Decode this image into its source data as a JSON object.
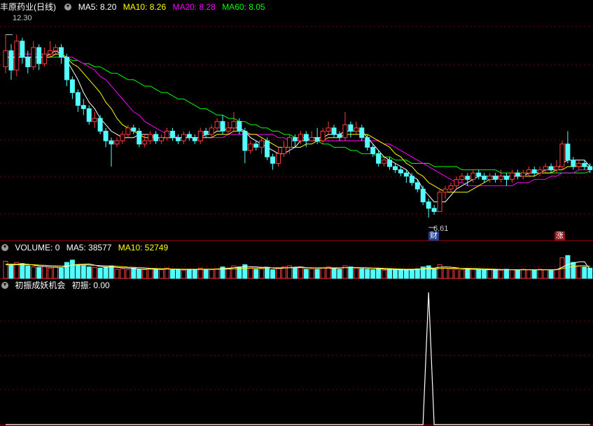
{
  "colors": {
    "up": "#ff3c3c",
    "down": "#54ffff",
    "ma5": "#ffffff",
    "ma10": "#ffff00",
    "ma20": "#ff00ff",
    "ma60": "#00ff00",
    "grid": "#7a0000",
    "vol_ma10": "#ffff00",
    "signal": "#ffffff"
  },
  "price_panel": {
    "stock_name": "丰原药业",
    "period": "(日线)",
    "ma5_label": "MA5: 8.20",
    "ma10_label": "MA10: 8.26",
    "ma20_label": "MA20: 8.28",
    "ma60_label": "MA60: 8.05",
    "high_label": "12.30",
    "low_label": "6.61",
    "badge_cai": "财",
    "badge_zhang": "涨"
  },
  "volume_panel": {
    "title": "VOLUME: 0",
    "ma5_label": "MA5: 38577",
    "ma10_label": "MA10: 52749"
  },
  "indicator_panel": {
    "title": "初振成妖机会",
    "value_label": "初振: 0.00"
  },
  "chart_data": [
    {
      "type": "candlestick",
      "title": "丰原药业(日线)",
      "high": 12.3,
      "low": 6.61,
      "ylim": [
        6.2,
        12.9
      ],
      "candles": [
        [
          11.3,
          11.8,
          12.3,
          11.1
        ],
        [
          11.8,
          11.2,
          12.0,
          10.9
        ],
        [
          11.2,
          12.1,
          12.3,
          11.0
        ],
        [
          12.1,
          11.6,
          12.2,
          11.4
        ],
        [
          11.6,
          11.3,
          11.8,
          11.1
        ],
        [
          11.3,
          11.9,
          12.1,
          11.2
        ],
        [
          11.9,
          11.4,
          12.0,
          11.2
        ],
        [
          11.4,
          11.7,
          11.9,
          11.3
        ],
        [
          11.7,
          11.8,
          12.1,
          11.6
        ],
        [
          11.8,
          11.9,
          12.0,
          11.7
        ],
        [
          11.9,
          11.6,
          12.0,
          11.4
        ],
        [
          11.6,
          10.9,
          11.7,
          10.7
        ],
        [
          10.9,
          10.5,
          11.0,
          10.3
        ],
        [
          10.5,
          10.1,
          10.6,
          9.9
        ],
        [
          10.1,
          10.0,
          10.3,
          9.8
        ],
        [
          10.0,
          9.6,
          10.1,
          9.5
        ],
        [
          9.6,
          9.7,
          9.9,
          9.4
        ],
        [
          9.7,
          9.3,
          9.8,
          9.2
        ],
        [
          9.3,
          9.0,
          9.4,
          8.8
        ],
        [
          9.0,
          8.9,
          9.1,
          8.2
        ],
        [
          8.9,
          9.0,
          9.1,
          8.8
        ],
        [
          9.0,
          9.2,
          9.3,
          8.9
        ],
        [
          9.2,
          9.4,
          9.5,
          9.1
        ],
        [
          9.4,
          9.3,
          9.5,
          9.2
        ],
        [
          9.3,
          8.9,
          9.4,
          8.8
        ],
        [
          8.9,
          9.0,
          9.2,
          8.8
        ],
        [
          9.0,
          9.2,
          9.3,
          8.9
        ],
        [
          9.2,
          9.0,
          9.3,
          8.9
        ],
        [
          9.0,
          9.1,
          9.2,
          8.9
        ],
        [
          9.1,
          9.3,
          9.4,
          9.0
        ],
        [
          9.3,
          9.1,
          9.4,
          9.0
        ],
        [
          9.1,
          9.0,
          9.2,
          8.9
        ],
        [
          9.0,
          9.2,
          9.3,
          8.9
        ],
        [
          9.2,
          9.1,
          9.3,
          9.0
        ],
        [
          9.1,
          9.0,
          9.2,
          8.9
        ],
        [
          9.0,
          9.3,
          9.4,
          8.9
        ],
        [
          9.3,
          9.2,
          9.4,
          9.1
        ],
        [
          9.2,
          9.4,
          9.5,
          9.1
        ],
        [
          9.4,
          9.6,
          9.7,
          9.3
        ],
        [
          9.6,
          9.3,
          9.8,
          9.2
        ],
        [
          9.3,
          9.4,
          9.6,
          9.2
        ],
        [
          9.4,
          9.6,
          9.9,
          9.3
        ],
        [
          9.6,
          9.3,
          9.7,
          9.2
        ],
        [
          9.3,
          8.7,
          9.4,
          8.3
        ],
        [
          8.7,
          8.9,
          9.0,
          8.6
        ],
        [
          8.9,
          8.8,
          9.0,
          8.7
        ],
        [
          8.8,
          9.0,
          9.1,
          8.6
        ],
        [
          9.0,
          8.5,
          9.1,
          8.4
        ],
        [
          8.5,
          8.3,
          8.6,
          8.1
        ],
        [
          8.3,
          8.6,
          8.8,
          8.2
        ],
        [
          8.6,
          8.8,
          9.0,
          8.5
        ],
        [
          8.8,
          9.1,
          9.2,
          8.6
        ],
        [
          9.1,
          9.0,
          9.2,
          8.8
        ],
        [
          9.0,
          9.2,
          9.3,
          8.9
        ],
        [
          9.2,
          9.0,
          9.3,
          8.8
        ],
        [
          9.0,
          9.1,
          9.3,
          9.0
        ],
        [
          9.1,
          9.0,
          9.4,
          8.9
        ],
        [
          9.0,
          9.3,
          9.4,
          8.9
        ],
        [
          9.3,
          9.4,
          9.6,
          9.2
        ],
        [
          9.4,
          9.2,
          9.5,
          9.1
        ],
        [
          9.2,
          9.1,
          9.3,
          9.0
        ],
        [
          9.1,
          9.5,
          9.9,
          9.0
        ],
        [
          9.5,
          9.3,
          9.6,
          9.1
        ],
        [
          9.3,
          9.4,
          9.6,
          9.2
        ],
        [
          9.4,
          9.1,
          9.5,
          9.0
        ],
        [
          9.1,
          8.8,
          9.2,
          8.7
        ],
        [
          8.8,
          8.6,
          8.9,
          8.5
        ],
        [
          8.6,
          8.3,
          8.7,
          8.2
        ],
        [
          8.3,
          8.4,
          8.5,
          8.2
        ],
        [
          8.4,
          8.2,
          8.5,
          8.1
        ],
        [
          8.2,
          8.1,
          8.3,
          8.0
        ],
        [
          8.1,
          8.0,
          8.2,
          7.9
        ],
        [
          8.0,
          7.9,
          8.1,
          7.7
        ],
        [
          7.9,
          7.7,
          8.0,
          7.6
        ],
        [
          7.7,
          7.5,
          7.8,
          7.4
        ],
        [
          7.5,
          7.1,
          7.6,
          7.0
        ],
        [
          7.1,
          6.9,
          7.2,
          6.61
        ],
        [
          6.9,
          6.8,
          7.0,
          6.7
        ],
        [
          6.8,
          7.4,
          7.5,
          6.8
        ],
        [
          7.4,
          7.5,
          7.6,
          7.2
        ],
        [
          7.5,
          7.6,
          7.7,
          7.4
        ],
        [
          7.6,
          7.8,
          7.9,
          7.5
        ],
        [
          7.8,
          7.9,
          8.0,
          7.7
        ],
        [
          7.9,
          7.8,
          8.0,
          7.6
        ],
        [
          7.8,
          8.0,
          8.1,
          7.7
        ],
        [
          8.0,
          7.9,
          8.1,
          7.8
        ],
        [
          7.9,
          7.8,
          8.0,
          7.7
        ],
        [
          7.8,
          7.9,
          8.0,
          7.7
        ],
        [
          7.9,
          7.8,
          8.0,
          7.7
        ],
        [
          7.8,
          7.9,
          8.1,
          7.7
        ],
        [
          7.9,
          7.8,
          8.0,
          7.6
        ],
        [
          7.8,
          8.0,
          8.1,
          7.7
        ],
        [
          8.0,
          7.9,
          8.1,
          7.8
        ],
        [
          7.9,
          8.0,
          8.1,
          7.8
        ],
        [
          8.0,
          8.1,
          8.2,
          7.9
        ],
        [
          8.1,
          8.0,
          8.2,
          7.9
        ],
        [
          8.0,
          8.1,
          8.2,
          7.9
        ],
        [
          8.1,
          8.2,
          8.3,
          8.0
        ],
        [
          8.2,
          8.1,
          8.3,
          8.0
        ],
        [
          8.1,
          8.2,
          8.4,
          8.0
        ],
        [
          8.2,
          8.9,
          9.0,
          8.1
        ],
        [
          8.9,
          8.4,
          9.3,
          8.3
        ],
        [
          8.4,
          8.2,
          8.5,
          8.1
        ],
        [
          8.2,
          8.3,
          8.4,
          8.1
        ],
        [
          8.3,
          8.2,
          8.4,
          8.1
        ],
        [
          8.2,
          8.1,
          8.3,
          8.0
        ]
      ],
      "ma5": [
        11.6,
        11.6,
        11.6,
        11.6,
        11.6,
        11.6,
        11.6,
        11.6,
        11.7,
        11.8,
        11.7,
        11.5,
        11.2,
        10.9,
        10.5,
        10.2,
        10.0,
        9.7,
        9.5,
        9.3,
        9.2,
        9.1,
        9.1,
        9.1,
        9.2,
        9.2,
        9.2,
        9.1,
        9.1,
        9.1,
        9.1,
        9.1,
        9.1,
        9.1,
        9.1,
        9.1,
        9.2,
        9.2,
        9.3,
        9.3,
        9.4,
        9.4,
        9.4,
        9.3,
        9.1,
        9.0,
        8.9,
        8.8,
        8.7,
        8.6,
        8.6,
        8.7,
        8.8,
        9.0,
        9.0,
        9.1,
        9.1,
        9.1,
        9.2,
        9.2,
        9.2,
        9.3,
        9.3,
        9.3,
        9.3,
        9.1,
        8.9,
        8.7,
        8.5,
        8.4,
        8.3,
        8.2,
        8.1,
        7.9,
        7.8,
        7.5,
        7.3,
        7.1,
        7.1,
        7.1,
        7.3,
        7.5,
        7.6,
        7.7,
        7.8,
        7.9,
        7.9,
        7.9,
        7.9,
        7.9,
        7.9,
        7.9,
        7.9,
        7.9,
        8.0,
        8.0,
        8.0,
        8.1,
        8.1,
        8.1,
        8.3,
        8.4,
        8.4,
        8.4,
        8.4,
        8.2
      ],
      "ma10": [
        11.6,
        11.6,
        11.6,
        11.6,
        11.6,
        11.6,
        11.6,
        11.6,
        11.6,
        11.7,
        11.7,
        11.6,
        11.4,
        11.3,
        11.1,
        10.9,
        10.7,
        10.5,
        10.2,
        10.0,
        9.7,
        9.5,
        9.4,
        9.3,
        9.2,
        9.1,
        9.1,
        9.1,
        9.1,
        9.1,
        9.1,
        9.1,
        9.1,
        9.1,
        9.1,
        9.1,
        9.1,
        9.1,
        9.2,
        9.2,
        9.2,
        9.3,
        9.3,
        9.3,
        9.2,
        9.2,
        9.1,
        9.0,
        8.9,
        8.8,
        8.8,
        8.8,
        8.8,
        8.8,
        8.9,
        8.9,
        9.0,
        9.0,
        9.1,
        9.1,
        9.1,
        9.2,
        9.2,
        9.2,
        9.2,
        9.2,
        9.1,
        9.0,
        8.9,
        8.8,
        8.6,
        8.5,
        8.3,
        8.2,
        8.0,
        7.9,
        7.7,
        7.6,
        7.5,
        7.4,
        7.4,
        7.4,
        7.4,
        7.4,
        7.5,
        7.6,
        7.7,
        7.8,
        7.8,
        7.9,
        7.9,
        7.9,
        7.9,
        7.9,
        7.9,
        7.9,
        8.0,
        8.0,
        8.0,
        8.1,
        8.1,
        8.2,
        8.2,
        8.2,
        8.2,
        8.2
      ],
      "ma20": [
        11.7,
        11.7,
        11.7,
        11.7,
        11.7,
        11.7,
        11.7,
        11.7,
        11.7,
        11.7,
        11.7,
        11.6,
        11.6,
        11.5,
        11.4,
        11.3,
        11.2,
        11.0,
        10.9,
        10.7,
        10.5,
        10.3,
        10.1,
        9.9,
        9.8,
        9.6,
        9.5,
        9.4,
        9.3,
        9.2,
        9.2,
        9.1,
        9.1,
        9.1,
        9.1,
        9.1,
        9.1,
        9.1,
        9.1,
        9.1,
        9.2,
        9.2,
        9.2,
        9.2,
        9.2,
        9.2,
        9.2,
        9.2,
        9.2,
        9.1,
        9.1,
        9.0,
        9.0,
        9.0,
        9.0,
        9.0,
        9.0,
        9.0,
        9.0,
        9.0,
        9.0,
        9.0,
        9.0,
        9.0,
        9.0,
        9.0,
        9.0,
        9.0,
        8.9,
        8.9,
        8.8,
        8.7,
        8.6,
        8.5,
        8.4,
        8.3,
        8.2,
        8.1,
        8.0,
        7.9,
        7.8,
        7.7,
        7.7,
        7.6,
        7.6,
        7.6,
        7.6,
        7.6,
        7.6,
        7.6,
        7.6,
        7.6,
        7.7,
        7.7,
        7.7,
        7.8,
        7.8,
        7.8,
        7.9,
        7.9,
        8.0,
        8.0,
        8.0,
        8.1,
        8.1,
        8.1
      ],
      "ma60": [
        11.6,
        11.6,
        11.6,
        11.6,
        11.6,
        11.6,
        11.6,
        11.6,
        11.6,
        11.6,
        11.6,
        11.6,
        11.5,
        11.5,
        11.4,
        11.4,
        11.3,
        11.3,
        11.2,
        11.1,
        11.1,
        11.0,
        10.9,
        10.9,
        10.8,
        10.7,
        10.7,
        10.6,
        10.5,
        10.5,
        10.4,
        10.3,
        10.3,
        10.2,
        10.1,
        10.0,
        10.0,
        9.9,
        9.8,
        9.8,
        9.7,
        9.7,
        9.6,
        9.6,
        9.5,
        9.5,
        9.4,
        9.4,
        9.3,
        9.3,
        9.2,
        9.2,
        9.1,
        9.1,
        9.1,
        9.0,
        9.0,
        8.9,
        8.9,
        8.8,
        8.8,
        8.8,
        8.7,
        8.7,
        8.6,
        8.6,
        8.6,
        8.5,
        8.5,
        8.5,
        8.4,
        8.4,
        8.4,
        8.3,
        8.3,
        8.3,
        8.3,
        8.2,
        8.2,
        8.2,
        8.2,
        8.2,
        8.1,
        8.1,
        8.1,
        8.1,
        8.1,
        8.1,
        8.1,
        8.0,
        8.0,
        8.0,
        8.0,
        8.0,
        8.0,
        8.0,
        8.0,
        8.0,
        8.0,
        8.0,
        8.0,
        8.0,
        8.0,
        8.0,
        8.0,
        8.05
      ]
    },
    {
      "type": "bar",
      "title": "VOLUME",
      "values": [
        75,
        60,
        70,
        65,
        55,
        50,
        48,
        52,
        45,
        50,
        45,
        70,
        80,
        60,
        55,
        50,
        48,
        45,
        50,
        55,
        40,
        42,
        38,
        45,
        40,
        38,
        42,
        40,
        38,
        45,
        40,
        38,
        36,
        40,
        38,
        45,
        40,
        38,
        42,
        50,
        45,
        55,
        50,
        60,
        45,
        40,
        42,
        48,
        38,
        44,
        50,
        55,
        45,
        48,
        40,
        42,
        40,
        46,
        50,
        45,
        40,
        55,
        50,
        45,
        42,
        40,
        38,
        42,
        36,
        40,
        38,
        36,
        38,
        40,
        42,
        50,
        55,
        40,
        60,
        45,
        42,
        40,
        38,
        42,
        40,
        38,
        36,
        40,
        38,
        36,
        40,
        38,
        36,
        40,
        38,
        36,
        40,
        38,
        36,
        40,
        90,
        100,
        70,
        55,
        50,
        45
      ],
      "ma10": [
        60,
        60,
        60,
        60,
        60,
        60,
        58,
        57,
        56,
        55,
        54,
        55,
        58,
        59,
        59,
        58,
        57,
        56,
        55,
        54,
        53,
        51,
        49,
        48,
        47,
        46,
        44,
        43,
        42,
        42,
        41,
        41,
        40,
        40,
        40,
        40,
        40,
        40,
        40,
        40,
        41,
        42,
        43,
        44,
        45,
        45,
        45,
        46,
        46,
        46,
        46,
        46,
        47,
        47,
        46,
        46,
        46,
        46,
        46,
        46,
        46,
        47,
        47,
        47,
        47,
        46,
        45,
        45,
        44,
        43,
        42,
        41,
        40,
        40,
        40,
        41,
        42,
        42,
        43,
        44,
        44,
        44,
        44,
        44,
        43,
        43,
        42,
        41,
        40,
        39,
        39,
        38,
        38,
        38,
        38,
        38,
        38,
        38,
        38,
        38,
        43,
        48,
        52,
        54,
        56,
        52.7
      ],
      "ma5": [
        62,
        62,
        62,
        62,
        62,
        58,
        54,
        52,
        50,
        49,
        48,
        53,
        58,
        61,
        62,
        63,
        58,
        52,
        50,
        50,
        48,
        46,
        45,
        44,
        41,
        41,
        41,
        41,
        40,
        41,
        41,
        40,
        39,
        39,
        39,
        39,
        40,
        40,
        41,
        43,
        44,
        47,
        49,
        52,
        51,
        50,
        48,
        49,
        45,
        43,
        45,
        47,
        49,
        50,
        47,
        46,
        45,
        45,
        45,
        44,
        45,
        47,
        48,
        47,
        46,
        45,
        44,
        43,
        40,
        39,
        39,
        38,
        37,
        38,
        39,
        41,
        45,
        45,
        49,
        50,
        49,
        46,
        43,
        41,
        40,
        39,
        38,
        38,
        38,
        38,
        38,
        38,
        38,
        38,
        38,
        38,
        38,
        38,
        38,
        38,
        49,
        60,
        67,
        72,
        73,
        38.6
      ]
    },
    {
      "type": "line",
      "title": "初振成妖机会",
      "series": [
        {
          "name": "初振",
          "spike_index": 76,
          "spike_value": 1,
          "baseline": 0
        }
      ]
    }
  ]
}
